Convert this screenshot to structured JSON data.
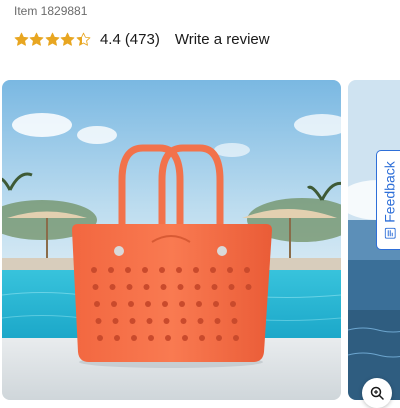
{
  "product": {
    "item_number": "Item 1829881",
    "rating": {
      "value": "4.4",
      "stars_filled": 4.4,
      "stars_total": 5,
      "review_count": "(473)",
      "star_color": "#e8a621"
    },
    "write_review_label": "Write a review"
  },
  "gallery": {
    "active_image": "orange-perforated-tote-bag-poolside",
    "next_image": "pool-water-and-sky",
    "zoom_icon": "zoom-in-icon"
  },
  "feedback_tab": {
    "label": "Feedback",
    "icon": "feedback-icon",
    "accent_color": "#2e6fd8"
  }
}
